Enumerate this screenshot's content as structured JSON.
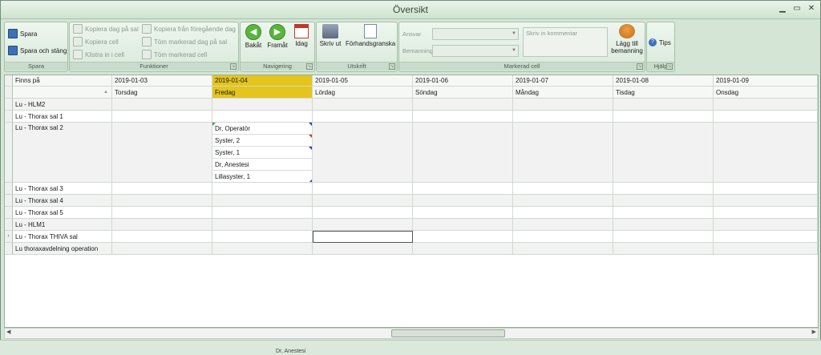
{
  "window": {
    "title": "Översikt"
  },
  "ribbon": {
    "spara": {
      "label": "Spara",
      "save": "Spara",
      "save_close": "Spara och stäng"
    },
    "funktioner": {
      "label": "Funktioner",
      "copy_day_sal": "Kopiera dag på sal",
      "copy_cell": "Kopiera cell",
      "paste_cell": "Klistra in i cell",
      "copy_prev_day": "Kopiera från föregående dag",
      "clear_day_sal": "Töm markerad dag på sal",
      "clear_cell": "Töm markerad cell"
    },
    "navigering": {
      "label": "Navigering",
      "back": "Bakåt",
      "forward": "Framåt",
      "today": "Idag"
    },
    "utskrift": {
      "label": "Utskrift",
      "print": "Skriv ut",
      "preview": "Förhandsgranska"
    },
    "markerad_cell": {
      "label": "Markerad cell",
      "ansvar": "Ansvar",
      "bemanning": "Bemanning",
      "comment_placeholder": "Skriv in kommentar",
      "add_staff_l1": "Lägg till",
      "add_staff_l2": "bemanning"
    },
    "hjalp": {
      "label": "Hjälp",
      "tips": "Tips"
    }
  },
  "grid": {
    "first_col_header": "Finns på",
    "columns": [
      {
        "date": "2019-01-03",
        "day": "Torsdag"
      },
      {
        "date": "2019-01-04",
        "day": "Fredag"
      },
      {
        "date": "2019-01-05",
        "day": "Lördag"
      },
      {
        "date": "2019-01-06",
        "day": "Söndag"
      },
      {
        "date": "2019-01-07",
        "day": "Måndag"
      },
      {
        "date": "2019-01-08",
        "day": "Tisdag"
      },
      {
        "date": "2019-01-09",
        "day": "Onsdag"
      }
    ],
    "rows": [
      "Lu - HLM2",
      "Lu - Thorax sal 1",
      "Lu - Thorax sal 2",
      "Lu - Thorax sal 3",
      "Lu - Thorax sal 4",
      "Lu - Thorax sal 5",
      "Lu - HLM1",
      "Lu - Thorax THIVA sal",
      "Lu thoraxavdelning operation"
    ],
    "sal2_entries": [
      "Dr, Operatör",
      "Syster, 2",
      "Syster, 1",
      "Dr, Anestesi",
      "Lillasyster, 1"
    ]
  },
  "status": {
    "text": "Dr, Anestesi"
  }
}
